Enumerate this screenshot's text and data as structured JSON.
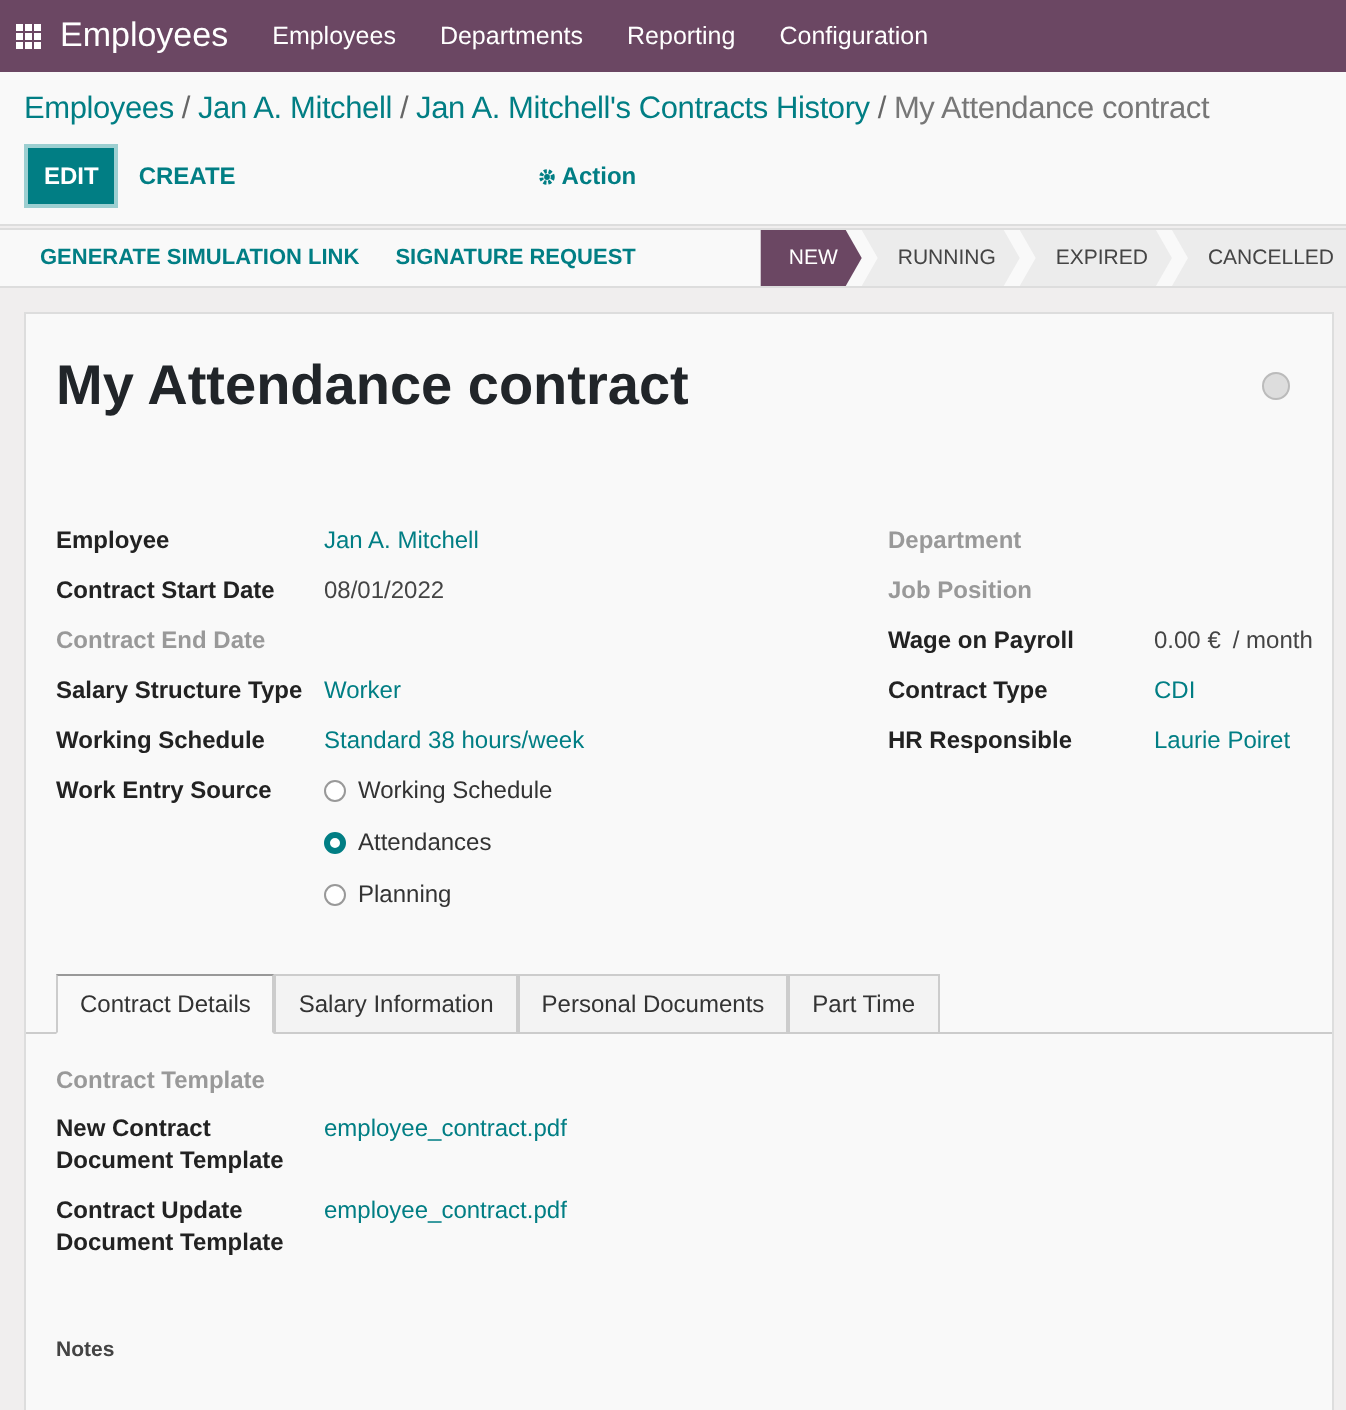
{
  "navbar": {
    "app": "Employees",
    "menu": [
      "Employees",
      "Departments",
      "Reporting",
      "Configuration"
    ]
  },
  "breadcrumbs": {
    "links": [
      "Employees",
      "Jan A. Mitchell",
      "Jan A. Mitchell's Contracts History"
    ],
    "current": "My Attendance contract",
    "separator": "/"
  },
  "buttons": {
    "edit": "EDIT",
    "create": "CREATE",
    "action": "Action"
  },
  "header_buttons": [
    "GENERATE SIMULATION LINK",
    "SIGNATURE REQUEST"
  ],
  "stages": [
    {
      "label": "NEW",
      "selected": true
    },
    {
      "label": "RUNNING",
      "selected": false
    },
    {
      "label": "EXPIRED",
      "selected": false
    },
    {
      "label": "CANCELLED",
      "selected": false
    }
  ],
  "title": "My Attendance contract",
  "left_fields": [
    {
      "label": "Employee",
      "kind": "link",
      "value": "Jan A. Mitchell"
    },
    {
      "label": "Contract Start Date",
      "kind": "plain",
      "value": "08/01/2022"
    },
    {
      "label": "Contract End Date",
      "kind": "empty"
    },
    {
      "label": "Salary Structure Type",
      "kind": "link",
      "value": "Worker"
    },
    {
      "label": "Working Schedule",
      "kind": "link",
      "value": "Standard 38 hours/week"
    }
  ],
  "work_entry_source": {
    "label": "Work Entry Source",
    "options": [
      {
        "label": "Working Schedule",
        "selected": false
      },
      {
        "label": "Attendances",
        "selected": true
      },
      {
        "label": "Planning",
        "selected": false
      }
    ]
  },
  "right_fields": [
    {
      "label": "Department",
      "kind": "empty"
    },
    {
      "label": "Job Position",
      "kind": "empty"
    },
    {
      "label": "Wage on Payroll",
      "kind": "plain",
      "value": "0.00 €",
      "unit": "/ month"
    },
    {
      "label": "Contract Type",
      "kind": "link",
      "value": "CDI"
    },
    {
      "label": "HR Responsible",
      "kind": "link",
      "value": "Laurie Poiret"
    }
  ],
  "tabs": [
    {
      "label": "Contract Details",
      "selected": true
    },
    {
      "label": "Salary Information",
      "selected": false
    },
    {
      "label": "Personal Documents",
      "selected": false
    },
    {
      "label": "Part Time",
      "selected": false
    }
  ],
  "contract_details": {
    "section": "Contract Template",
    "fields": [
      {
        "label": "New Contract Document Template",
        "kind": "link",
        "value": "employee_contract.pdf"
      },
      {
        "label": "Contract Update Document Template",
        "kind": "link",
        "value": "employee_contract.pdf"
      }
    ],
    "notes_label": "Notes"
  }
}
